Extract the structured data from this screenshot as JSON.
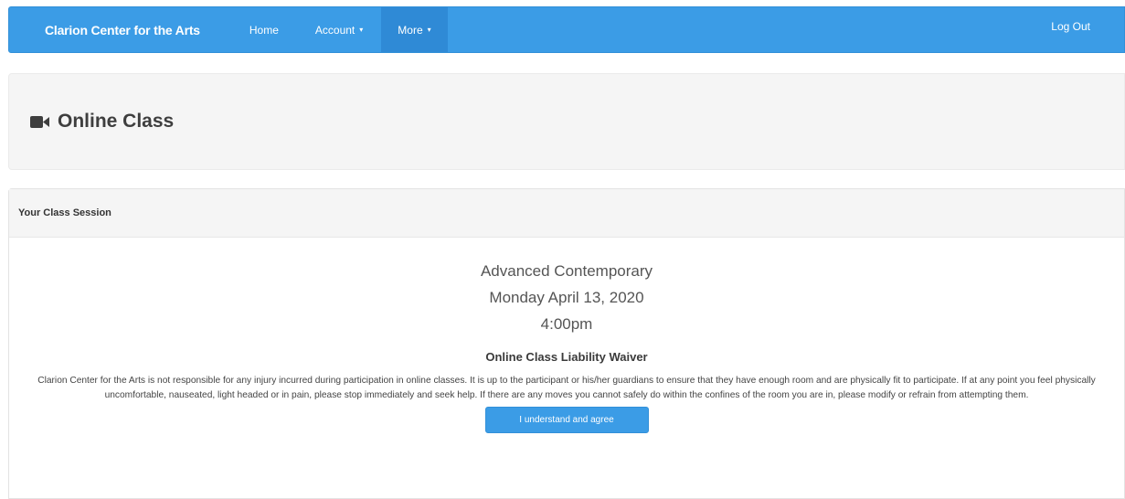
{
  "navbar": {
    "brand": "Clarion Center for the Arts",
    "items": [
      {
        "label": "Home",
        "has_dropdown": false
      },
      {
        "label": "Account",
        "has_dropdown": true
      },
      {
        "label": "More",
        "has_dropdown": true,
        "open": true
      }
    ],
    "logout_label": "Log Out",
    "caret_glyph": "▾",
    "color": "#3b9ce6"
  },
  "page": {
    "title": "Online Class",
    "title_icon": "video-camera-icon"
  },
  "session": {
    "heading": "Your Class Session",
    "class_name": "Advanced Contemporary",
    "date": "Monday April 13, 2020",
    "time": "4:00pm",
    "waiver_title": "Online Class Liability Waiver",
    "waiver_text": "Clarion Center for the Arts is not responsible for any injury incurred during participation in online classes. It is up to the participant or his/her guardians to ensure that they have enough room and are physically fit to participate. If at any point you feel physically uncomfortable, nauseated, light headed or in pain, please stop immediately and seek help. If there are any moves you cannot safely do within the confines of the room you are in, please modify or refrain from attempting them.",
    "agree_label": "I understand and agree"
  }
}
